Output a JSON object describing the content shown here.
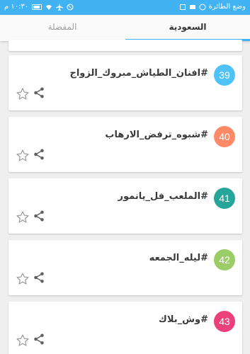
{
  "status_bar": {
    "time": "١٠:٣٠ م",
    "right_text": "وضع الطائرة"
  },
  "tabs": [
    {
      "label": "المفضلة",
      "active": false
    },
    {
      "label": "السعودية",
      "active": true
    }
  ],
  "colors": {
    "primary": "#42b3f2",
    "card_bg": "#ffffff",
    "page_bg": "#efefef"
  },
  "hashtags": [
    {
      "number": "39",
      "text": "#افنان_الطياش_مبروك_الزواج",
      "color": "#4fc3f7"
    },
    {
      "number": "40",
      "text": "#شبوه_ترفض_الارهاب",
      "color": "#ff8a65"
    },
    {
      "number": "41",
      "text": "#الملعب_فل_يانمور",
      "color": "#26a69a"
    },
    {
      "number": "42",
      "text": "#ليله_الجمعه",
      "color": "#9ccc65"
    },
    {
      "number": "43",
      "text": "#وش_بلاك",
      "color": "#ec407a"
    }
  ],
  "icons": {
    "favorite": "star-outline-icon",
    "share": "share-icon"
  }
}
